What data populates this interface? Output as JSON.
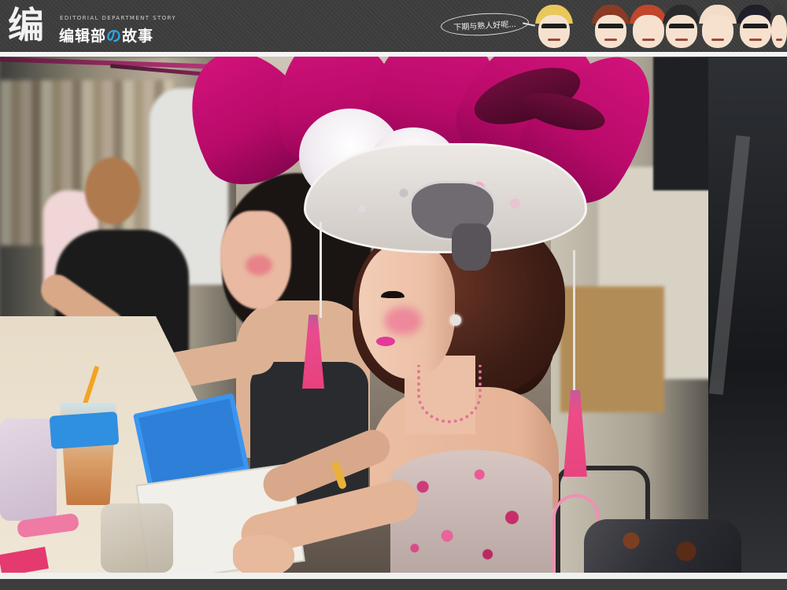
{
  "header": {
    "logo_glyph": "编",
    "logo_en": "EDITORIAL DEPARTMENT STORY",
    "logo_cn_left": "编辑部",
    "logo_cn_accent": "の",
    "logo_cn_right": "故事",
    "speech_text": "下期与熟人好呢...",
    "faces": [
      {
        "name": "face-red-scarf",
        "hair": "#e9c75a",
        "glasses": true,
        "scarf": true
      },
      {
        "name": "face-brown-hair",
        "hair": "#8a3b24",
        "glasses": true,
        "scarf": false
      },
      {
        "name": "face-red-hair",
        "hair": "#c0462c",
        "glasses": false,
        "scarf": false
      },
      {
        "name": "face-dark-hair",
        "hair": "#2b2b2b",
        "glasses": true,
        "scarf": false
      },
      {
        "name": "face-bald",
        "hair": "#f3ddc9",
        "glasses": false,
        "scarf": false
      },
      {
        "name": "face-long-dark-hair",
        "hair": "#1f1f2a",
        "glasses": true,
        "scarf": false
      },
      {
        "name": "face-partial",
        "hair": "#3b3b3b",
        "glasses": false,
        "scarf": false
      }
    ]
  },
  "colors": {
    "header_bg": "#3d3d3d",
    "accent_blue": "#2fa6e0",
    "feather_pink": "#c8107a",
    "tassel_pink": "#e8447f"
  },
  "photo": {
    "subject": "photo"
  }
}
